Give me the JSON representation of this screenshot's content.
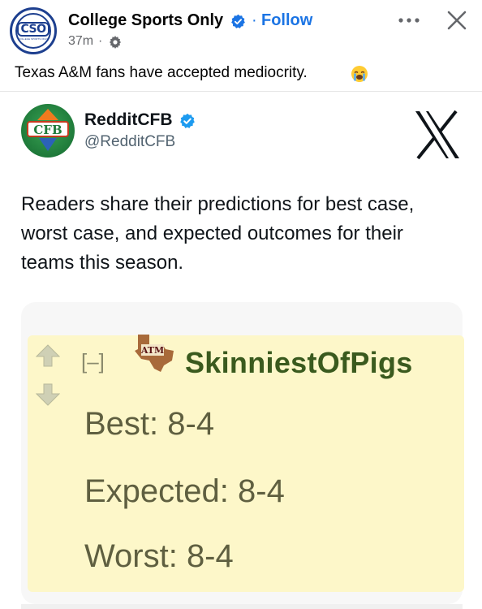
{
  "post": {
    "page_name": "College Sports Only",
    "follow_label": "Follow",
    "separator": "·",
    "time": "37m",
    "caption": "Texas A&M fans have accepted mediocrity.",
    "avatar_text": "CSO",
    "avatar_subtext": "COLLEGE SPORTS ONLY"
  },
  "tweet": {
    "name": "RedditCFB",
    "handle": "@RedditCFB",
    "avatar_text": "CFB",
    "text": "Readers share their predictions for best case, worst case, and expected outcomes for their teams this season."
  },
  "comment": {
    "collapse_label": "[–]",
    "username": "SkinniestOfPigs",
    "best": "Best: 8-4",
    "expected": "Expected: 8-4",
    "worst": "Worst: 8-4",
    "flair_text": "ATM"
  },
  "colors": {
    "facebook_blue": "#1b74e4",
    "comment_background": "#fdf7c9",
    "username_green": "#3a5a1e"
  },
  "icons": {
    "verified": "verified-badge-icon",
    "audience": "gear-icon",
    "more": "more-horizontal-icon",
    "close": "close-icon",
    "emoji": "loudly-crying-face-icon",
    "x_logo": "x-logo-icon",
    "upvote": "upvote-arrow-icon",
    "downvote": "downvote-arrow-icon",
    "flair": "texas-am-flair-icon"
  }
}
